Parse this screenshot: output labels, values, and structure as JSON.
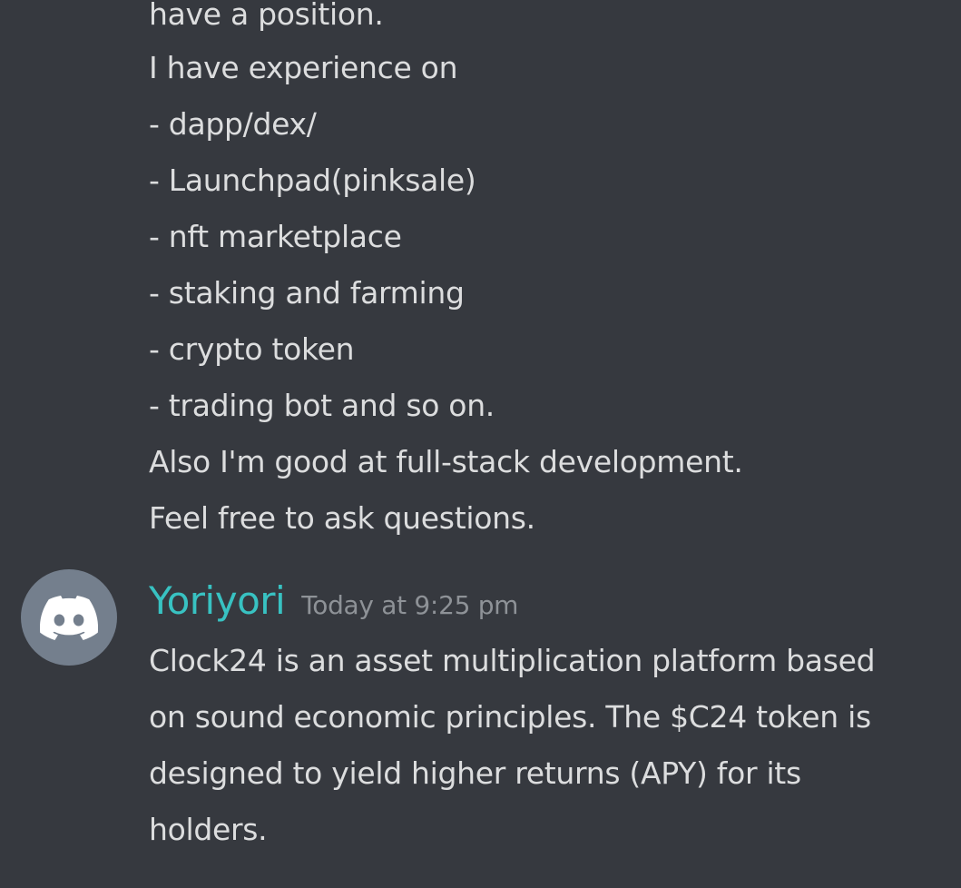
{
  "colors": {
    "background": "#36393f",
    "message_text": "#dcddde",
    "username": "#38c2c2",
    "timestamp": "#8e9297",
    "avatar_bg": "#747f8d"
  },
  "previous_message": {
    "lines": [
      "have a position.",
      "I have experience on",
      "- dapp/dex/",
      "- Launchpad(pinksale)",
      "- nft marketplace",
      "- staking and farming",
      "- crypto token",
      "- trading bot and so on.",
      "Also I'm good at full-stack development.",
      "Feel free to ask questions."
    ]
  },
  "message": {
    "avatar_icon": "discord-logo-icon",
    "username": "Yoriyori",
    "timestamp": "Today at 9:25 pm",
    "lines": [
      "Clock24  is an asset multiplication platform based",
      "on sound economic principles. The $C24 token is",
      "designed to yield higher returns (APY) for its",
      "holders."
    ]
  }
}
